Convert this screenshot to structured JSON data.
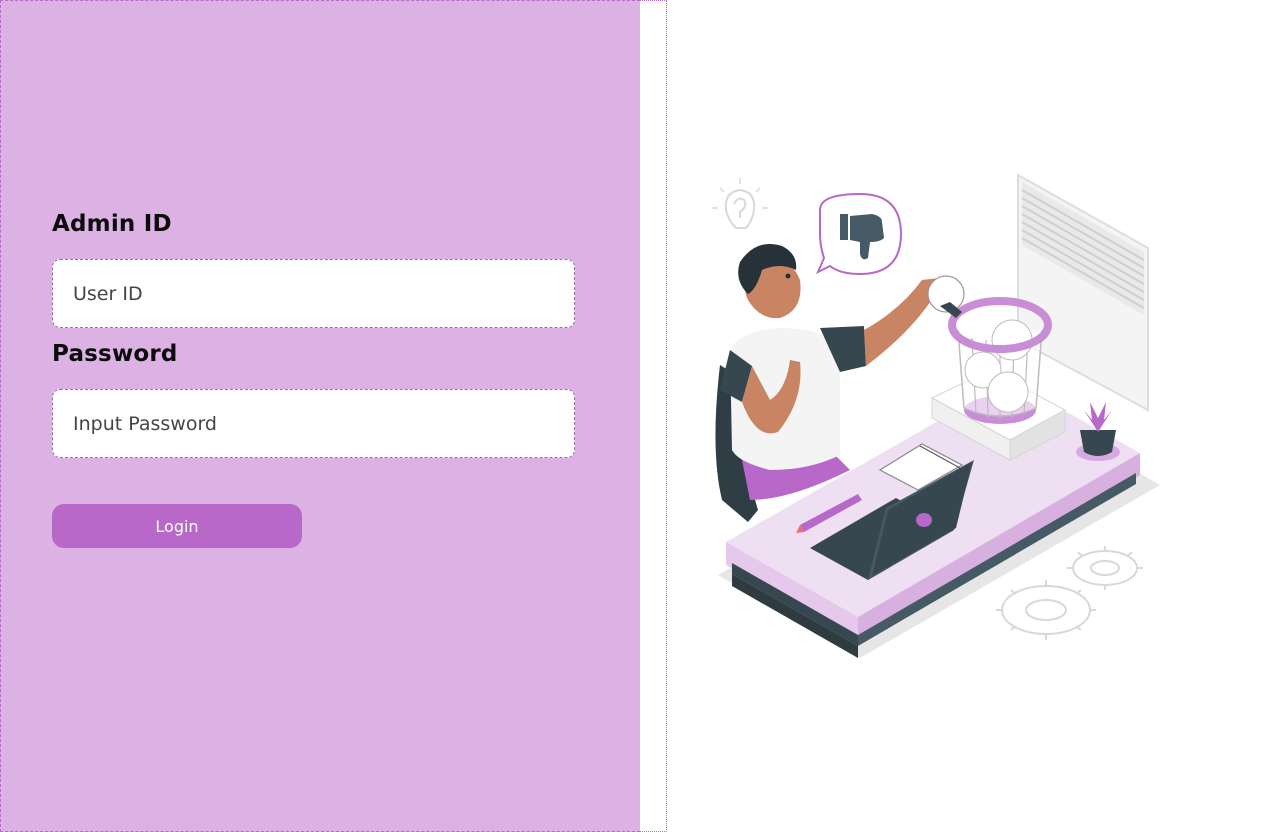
{
  "login_form": {
    "admin_label": "Admin ID",
    "user_id_placeholder": "User ID",
    "password_label": "Password",
    "password_placeholder": "Input Password",
    "login_button": "Login"
  },
  "colors": {
    "panel_background": "#dcb2e4",
    "accent": "#b868c8",
    "dark": "#37474f"
  },
  "illustration": {
    "icons": [
      "question-bulb-icon",
      "thumbs-down-icon",
      "gear-icon",
      "lightbulb-icon"
    ]
  }
}
